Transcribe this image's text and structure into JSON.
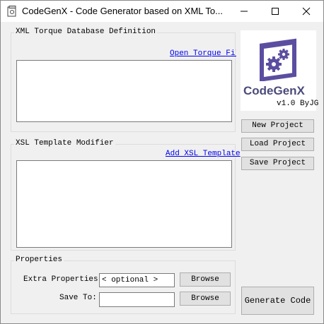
{
  "window": {
    "title": "CodeGenX - Code Generator based on XML To..."
  },
  "xml_group": {
    "title": "XML Torque Database Definition",
    "link": "Open Torque File"
  },
  "xsl_group": {
    "title": "XSL Template Modifier",
    "link": "Add XSL Template"
  },
  "properties_group": {
    "title": "Properties",
    "extra_label": "Extra Properties F",
    "extra_value": "< optional >",
    "save_label": "Save To:",
    "save_value": "",
    "browse1": "Browse",
    "browse2": "Browse"
  },
  "logo": {
    "name": "CodeGenX",
    "version": "v1.0 ByJG"
  },
  "buttons": {
    "new_project": "New Project",
    "load_project": "Load Project",
    "save_project": "Save Project",
    "generate": "Generate Code"
  },
  "colors": {
    "link": "#0000ee",
    "logo_purple": "#5b4ea0",
    "logo_text": "#4b4b7a"
  }
}
